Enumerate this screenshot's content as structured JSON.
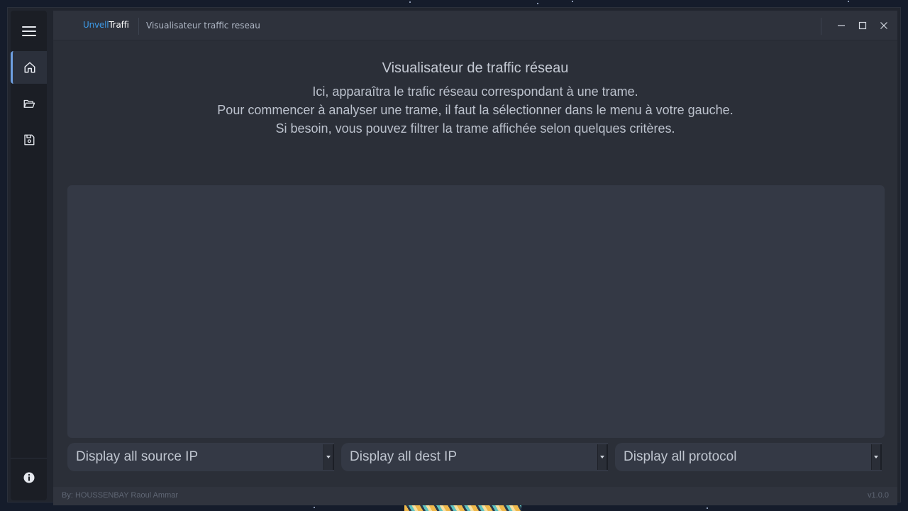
{
  "colors": {
    "accent": "#3d9be9",
    "active_indicator": "#6e9fe0",
    "background": "#2b2f38",
    "panel": "#343945"
  },
  "titlebar": {
    "logo_part1": "Unvell",
    "logo_part2": "Traffic",
    "app_title": "Visualisateur traffic reseau",
    "controls": [
      "minimize-icon",
      "maximize-icon",
      "close-icon"
    ]
  },
  "left_menu": {
    "items": [
      {
        "name": "home",
        "icon": "home-icon",
        "active": true
      },
      {
        "name": "open",
        "icon": "folder-open-icon",
        "active": false
      },
      {
        "name": "save",
        "icon": "save-icon",
        "active": false
      }
    ],
    "bottom_icon": "info-icon"
  },
  "main": {
    "heading": "Visualisateur de traffic réseau",
    "description_lines": [
      "Ici, apparaîtra le trafic réseau correspondant à une trame.",
      "Pour commencer à analyser une trame, il faut la sélectionner dans le menu à votre gauche.",
      "Si besoin, vous pouvez filtrer la trame affichée selon quelques critères."
    ]
  },
  "filters": {
    "source_ip": "Display all source IP",
    "dest_ip": "Display all dest IP",
    "protocol": "Display all protocol"
  },
  "footer": {
    "credit": "By: HOUSSENBAY Raoul Ammar",
    "version": "v1.0.0"
  }
}
